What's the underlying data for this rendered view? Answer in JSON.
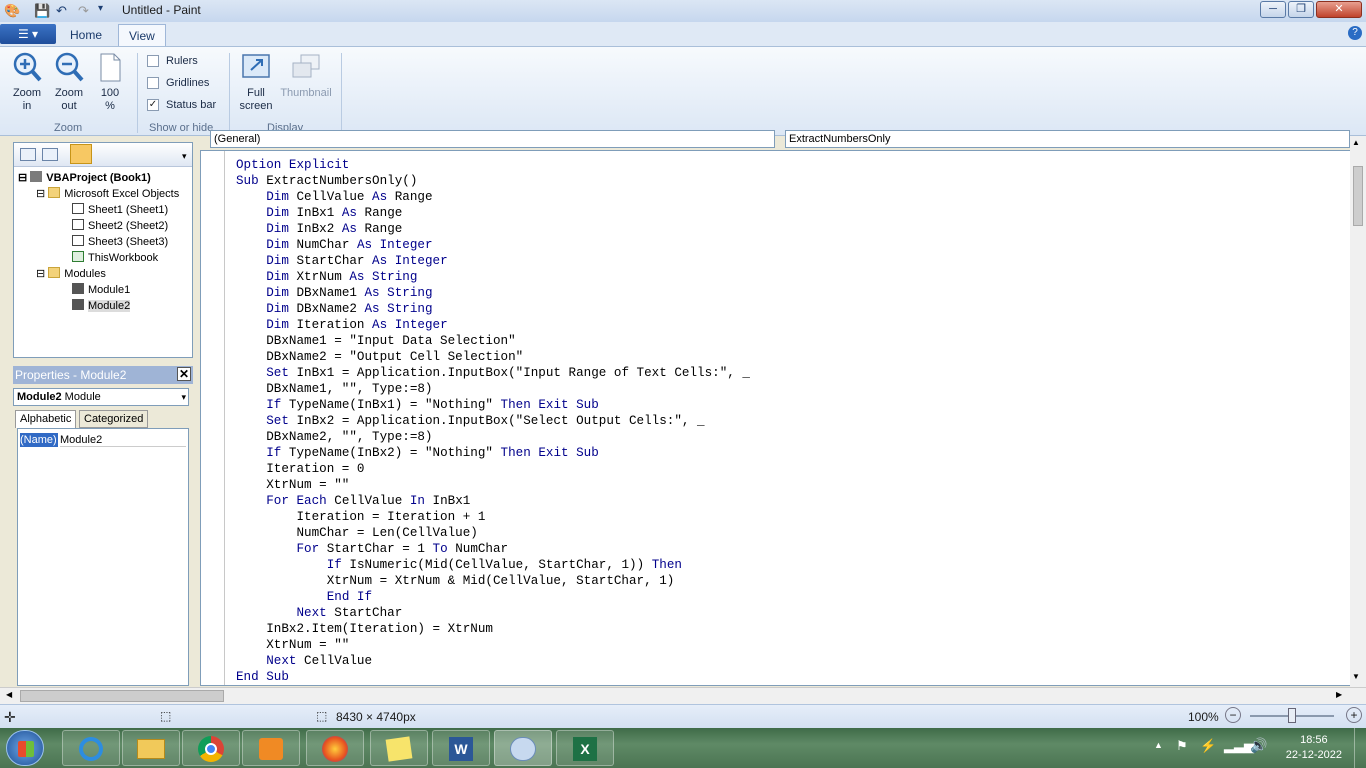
{
  "window": {
    "title": "Untitled - Paint",
    "minimize": "─",
    "maximize": "❐",
    "close": "✕"
  },
  "tabs": {
    "app_menu": "☰ ▾",
    "home": "Home",
    "view": "View"
  },
  "ribbon": {
    "zoom_in_l1": "Zoom",
    "zoom_in_l2": "in",
    "zoom_out_l1": "Zoom",
    "zoom_out_l2": "out",
    "zoom100_l1": "100",
    "zoom100_l2": "%",
    "zoom_group": "Zoom",
    "rulers": "Rulers",
    "gridlines": "Gridlines",
    "statusbar": "Status bar",
    "show_hide_group": "Show or hide",
    "fullscreen_l1": "Full",
    "fullscreen_l2": "screen",
    "thumbnail": "Thumbnail",
    "display_group": "Display"
  },
  "project": {
    "root": "VBAProject (Book1)",
    "folder_objects": "Microsoft Excel Objects",
    "sheet1": "Sheet1 (Sheet1)",
    "sheet2": "Sheet2 (Sheet2)",
    "sheet3": "Sheet3 (Sheet3)",
    "workbook": "ThisWorkbook",
    "folder_modules": "Modules",
    "module1": "Module1",
    "module2": "Module2"
  },
  "properties": {
    "title": "Properties - Module2",
    "combo_bold": "Module2",
    "combo_rest": " Module",
    "tab_alpha": "Alphabetic",
    "tab_cat": "Categorized",
    "name_key": "(Name)",
    "name_val": "Module2"
  },
  "code": {
    "combo_left": "(General)",
    "combo_right": "ExtractNumbersOnly",
    "lines": [
      [
        [
          "kw",
          "Option Explicit"
        ]
      ],
      [
        [
          "kw",
          "Sub "
        ],
        [
          "t",
          "ExtractNumbersOnly()"
        ]
      ],
      [
        [
          "t",
          "    "
        ],
        [
          "kw",
          "Dim "
        ],
        [
          "t",
          "CellValue "
        ],
        [
          "kw",
          "As "
        ],
        [
          "t",
          "Range"
        ]
      ],
      [
        [
          "t",
          "    "
        ],
        [
          "kw",
          "Dim "
        ],
        [
          "t",
          "InBx1 "
        ],
        [
          "kw",
          "As "
        ],
        [
          "t",
          "Range"
        ]
      ],
      [
        [
          "t",
          "    "
        ],
        [
          "kw",
          "Dim "
        ],
        [
          "t",
          "InBx2 "
        ],
        [
          "kw",
          "As "
        ],
        [
          "t",
          "Range"
        ]
      ],
      [
        [
          "t",
          "    "
        ],
        [
          "kw",
          "Dim "
        ],
        [
          "t",
          "NumChar "
        ],
        [
          "kw",
          "As Integer"
        ]
      ],
      [
        [
          "t",
          "    "
        ],
        [
          "kw",
          "Dim "
        ],
        [
          "t",
          "StartChar "
        ],
        [
          "kw",
          "As Integer"
        ]
      ],
      [
        [
          "t",
          "    "
        ],
        [
          "kw",
          "Dim "
        ],
        [
          "t",
          "XtrNum "
        ],
        [
          "kw",
          "As String"
        ]
      ],
      [
        [
          "t",
          "    "
        ],
        [
          "kw",
          "Dim "
        ],
        [
          "t",
          "DBxName1 "
        ],
        [
          "kw",
          "As String"
        ]
      ],
      [
        [
          "t",
          "    "
        ],
        [
          "kw",
          "Dim "
        ],
        [
          "t",
          "DBxName2 "
        ],
        [
          "kw",
          "As String"
        ]
      ],
      [
        [
          "t",
          "    "
        ],
        [
          "kw",
          "Dim "
        ],
        [
          "t",
          "Iteration "
        ],
        [
          "kw",
          "As Integer"
        ]
      ],
      [
        [
          "t",
          "    DBxName1 = \"Input Data Selection\""
        ]
      ],
      [
        [
          "t",
          "    DBxName2 = \"Output Cell Selection\""
        ]
      ],
      [
        [
          "t",
          "    "
        ],
        [
          "kw",
          "Set "
        ],
        [
          "t",
          "InBx1 = Application.InputBox(\"Input Range of Text Cells:\", _"
        ]
      ],
      [
        [
          "t",
          "    DBxName1, \"\", Type:=8)"
        ]
      ],
      [
        [
          "t",
          "    "
        ],
        [
          "kw",
          "If "
        ],
        [
          "t",
          "TypeName(InBx1) = \"Nothing\" "
        ],
        [
          "kw",
          "Then Exit Sub"
        ]
      ],
      [
        [
          "t",
          "    "
        ],
        [
          "kw",
          "Set "
        ],
        [
          "t",
          "InBx2 = Application.InputBox(\"Select Output Cells:\", _"
        ]
      ],
      [
        [
          "t",
          "    DBxName2, \"\", Type:=8)"
        ]
      ],
      [
        [
          "t",
          "    "
        ],
        [
          "kw",
          "If "
        ],
        [
          "t",
          "TypeName(InBx2) = \"Nothing\" "
        ],
        [
          "kw",
          "Then Exit Sub"
        ]
      ],
      [
        [
          "t",
          "    Iteration = 0"
        ]
      ],
      [
        [
          "t",
          "    XtrNum = \"\""
        ]
      ],
      [
        [
          "t",
          "    "
        ],
        [
          "kw",
          "For Each "
        ],
        [
          "t",
          "CellValue "
        ],
        [
          "kw",
          "In "
        ],
        [
          "t",
          "InBx1"
        ]
      ],
      [
        [
          "t",
          "        Iteration = Iteration + 1"
        ]
      ],
      [
        [
          "t",
          "        NumChar = Len(CellValue)"
        ]
      ],
      [
        [
          "t",
          "        "
        ],
        [
          "kw",
          "For "
        ],
        [
          "t",
          "StartChar = 1 "
        ],
        [
          "kw",
          "To "
        ],
        [
          "t",
          "NumChar"
        ]
      ],
      [
        [
          "t",
          "            "
        ],
        [
          "kw",
          "If "
        ],
        [
          "t",
          "IsNumeric(Mid(CellValue, StartChar, 1)) "
        ],
        [
          "kw",
          "Then"
        ]
      ],
      [
        [
          "t",
          "            XtrNum = XtrNum & Mid(CellValue, StartChar, 1)"
        ]
      ],
      [
        [
          "t",
          "            "
        ],
        [
          "kw",
          "End If"
        ]
      ],
      [
        [
          "t",
          "        "
        ],
        [
          "kw",
          "Next "
        ],
        [
          "t",
          "StartChar"
        ]
      ],
      [
        [
          "t",
          "    InBx2.Item(Iteration) = XtrNum"
        ]
      ],
      [
        [
          "t",
          "    XtrNum = \"\""
        ]
      ],
      [
        [
          "t",
          "    "
        ],
        [
          "kw",
          "Next "
        ],
        [
          "t",
          "CellValue"
        ]
      ],
      [
        [
          "kw",
          "End Sub"
        ]
      ]
    ]
  },
  "status": {
    "dimensions": "8430 × 4740px",
    "zoom": "100%"
  },
  "taskbar": {
    "time": "18:56",
    "date": "22-12-2022"
  }
}
